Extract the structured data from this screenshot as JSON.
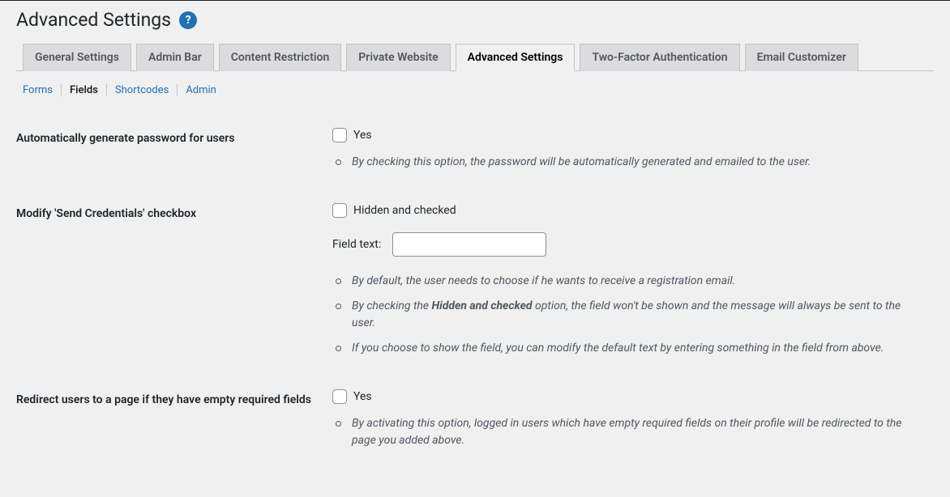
{
  "page": {
    "title": "Advanced Settings"
  },
  "tabs": {
    "items": [
      {
        "label": "General Settings",
        "active": false
      },
      {
        "label": "Admin Bar",
        "active": false
      },
      {
        "label": "Content Restriction",
        "active": false
      },
      {
        "label": "Private Website",
        "active": false
      },
      {
        "label": "Advanced Settings",
        "active": true
      },
      {
        "label": "Two-Factor Authentication",
        "active": false
      },
      {
        "label": "Email Customizer",
        "active": false
      }
    ]
  },
  "subtabs": {
    "items": [
      {
        "label": "Forms",
        "current": false
      },
      {
        "label": "Fields",
        "current": true
      },
      {
        "label": "Shortcodes",
        "current": false
      },
      {
        "label": "Admin",
        "current": false
      }
    ]
  },
  "settings": {
    "auto_generate_password": {
      "label": "Automatically generate password for users",
      "checkbox_label": "Yes",
      "checked": false,
      "description": [
        "By checking this option, the password will be automatically generated and emailed to the user."
      ]
    },
    "modify_send_credentials": {
      "label": "Modify 'Send Credentials' checkbox",
      "checkbox_label": "Hidden and checked",
      "checked": false,
      "field_text_label": "Field text:",
      "field_text_value": "",
      "description_pre": "By default, the user needs to choose if he wants to receive a registration email.",
      "description_mid_a": "By checking the ",
      "description_mid_strong": "Hidden and checked",
      "description_mid_b": " option, the field won't be shown and the message will always be sent to the user.",
      "description_post": "If you choose to show the field, you can modify the default text by entering something in the field from above."
    },
    "redirect_empty_required": {
      "label": "Redirect users to a page if they have empty required fields",
      "checkbox_label": "Yes",
      "checked": false,
      "description": [
        "By activating this option, logged in users which have empty required fields on their profile will be redirected to the page you added above."
      ]
    }
  }
}
